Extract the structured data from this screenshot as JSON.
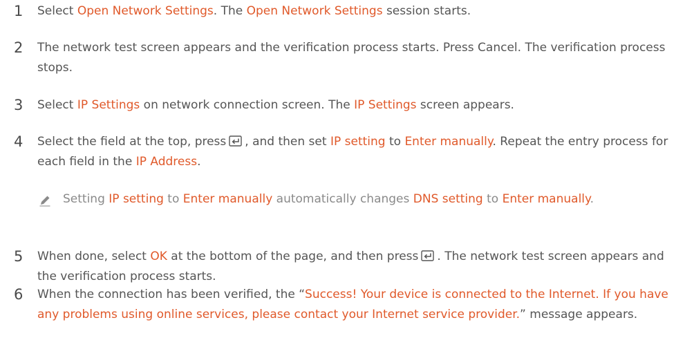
{
  "steps": [
    {
      "number": "1",
      "parts": [
        {
          "text": "Select "
        },
        {
          "text": "Open Network Settings",
          "hl": true
        },
        {
          "text": ". The "
        },
        {
          "text": "Open Network Settings",
          "hl": true
        },
        {
          "text": " session starts."
        }
      ]
    },
    {
      "number": "2",
      "parts": [
        {
          "text": "The network test screen appears and the verification process starts. Press Cancel. The verification process stops."
        }
      ]
    },
    {
      "number": "3",
      "parts": [
        {
          "text": "Select "
        },
        {
          "text": "IP Settings",
          "hl": true
        },
        {
          "text": " on network connection screen. The "
        },
        {
          "text": "IP Settings",
          "hl": true
        },
        {
          "text": " screen appears."
        }
      ]
    },
    {
      "number": "4",
      "parts": [
        {
          "text": "Select the field at the top, press"
        },
        {
          "icon": "enter-key-icon"
        },
        {
          "text": ", and then set "
        },
        {
          "text": "IP setting",
          "hl": true
        },
        {
          "text": " to "
        },
        {
          "text": "Enter manually",
          "hl": true
        },
        {
          "text": ". Repeat the entry process for each field in the "
        },
        {
          "text": "IP Address",
          "hl": true
        },
        {
          "text": "."
        }
      ]
    },
    {
      "note": true,
      "icon": "pencil-note-icon",
      "parts": [
        {
          "text": "Setting "
        },
        {
          "text": "IP setting",
          "hl": true
        },
        {
          "text": " to "
        },
        {
          "text": "Enter manually",
          "hl": true
        },
        {
          "text": " automatically changes "
        },
        {
          "text": "DNS setting",
          "hl": true
        },
        {
          "text": " to "
        },
        {
          "text": "Enter manually",
          "hl": true
        },
        {
          "text": "."
        }
      ]
    },
    {
      "number": "5",
      "parts": [
        {
          "text": "When done, select "
        },
        {
          "text": "OK",
          "hl": true
        },
        {
          "text": " at the bottom of the page, and then press"
        },
        {
          "icon": "enter-key-icon"
        },
        {
          "text": ". The network test screen appears and the verification process starts."
        }
      ]
    },
    {
      "number": "6",
      "parts": [
        {
          "text": "When the connection has been verified, the “"
        },
        {
          "text": "Success! Your device is connected to the Internet. If you have any problems using online services, please contact your Internet service provider.",
          "hl": true
        },
        {
          "text": "” message appears."
        }
      ]
    }
  ],
  "colors": {
    "highlight": "#e0592a",
    "text": "#555555",
    "note_text": "#8a8a8a"
  }
}
